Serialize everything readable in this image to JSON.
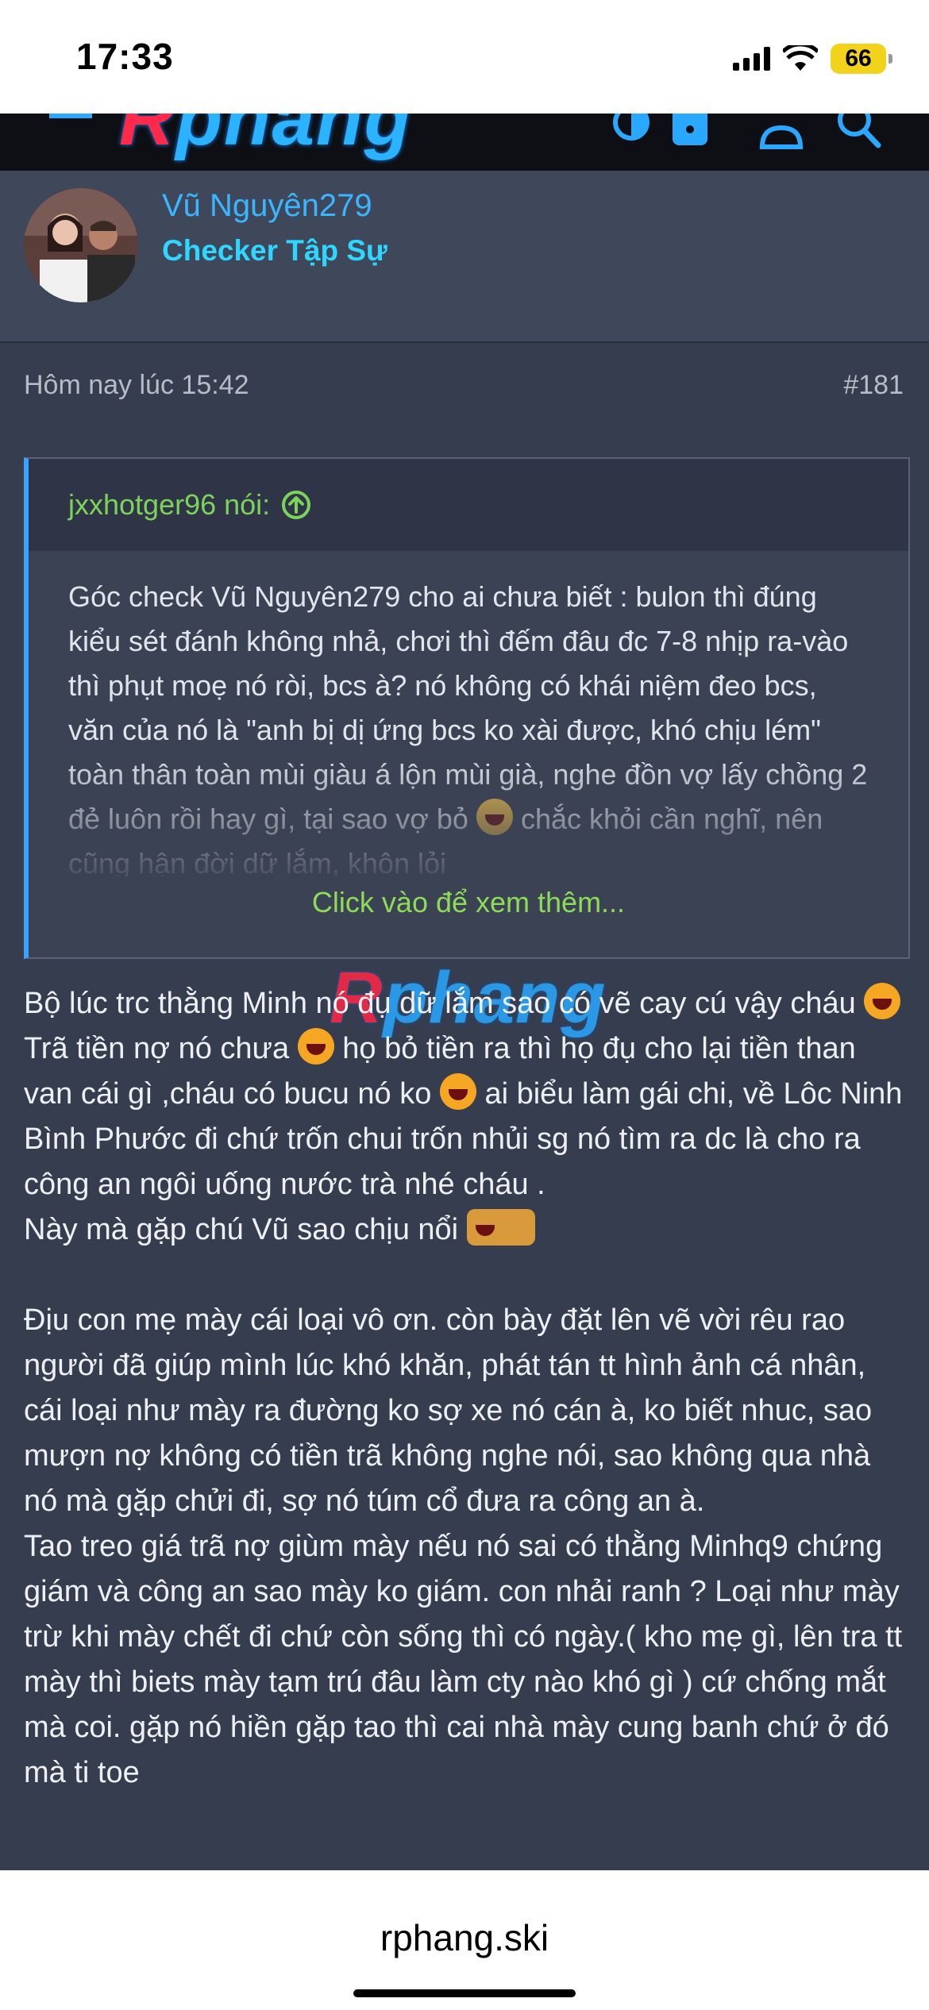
{
  "status_bar": {
    "time": "17:33",
    "battery": "66"
  },
  "header": {
    "logo": "Rphang"
  },
  "post": {
    "username": "Vũ Nguyên279",
    "user_title": "Checker Tập Sự",
    "timestamp": "Hôm nay lúc 15:42",
    "post_number": "#181",
    "quote": {
      "author": "jxxhotger96 nói:",
      "text": "Góc check Vũ Nguyên279 cho ai chưa biết : bulon thì đúng kiểu sét đánh không nhả, chơi thì đếm đâu đc 7-8 nhịp ra-vào thì phụt moẹ nó ròi, bcs à? nó không có khái niệm đeo bcs, văn của nó là \"anh bị dị ứng bcs ko xài được, khó chịu lém\" toàn thân toàn mùi giàu á lộn mùi già, nghe đồn vợ lấy chồng 2 đẻ luôn rồi hay gì, tại sao vợ bỏ",
      "text_faded": "chắc khỏi cần nghĩ, nên cũng hận đời dữ lắm, khôn lỏi",
      "more": "Click vào để xem thêm..."
    },
    "watermark": "Rphang",
    "body": {
      "p1_a": "Bộ lúc trc thằng Minh nó đụ dữ lắm sao có vẽ cay cú vậy cháu",
      "p1_b": "Trã tiền nợ nó chưa",
      "p1_c": "họ bỏ tiền ra thì họ đụ cho lại tiền than van cái gì ,cháu có bucu nó ko",
      "p1_d": "ai biểu làm gái chi, về Lôc Ninh Bình Phước đi chứ trốn chui trốn nhủi sg nó tìm ra dc là cho ra công an ngôi uống nước trà nhé cháu .",
      "p2": "Này mà gặp chú Vũ sao chịu nổi",
      "p3": "Địu con mẹ mày cái loại vô ơn. còn bày đặt lên vẽ vời rêu rao người đã giúp mình lúc khó khăn, phát tán tt hình ảnh cá nhân, cái loại như mày ra đường ko sợ xe nó cán à, ko biết nhuc, sao mượn nợ không có tiền trã không nghe nói, sao không qua nhà nó mà gặp chửi đi, sợ nó túm cổ đưa ra công an à.",
      "p4": "Tao treo giá trã nợ giùm mày nếu nó sai có thằng Minhq9 chứng giám và công an sao mày ko giám. con nhải ranh ? Loại như mày trừ khi mày chết đi chứ còn sống thì có ngày.( kho mẹ gì, lên tra tt mày thì biets mày tạm trú đâu làm cty nào khó gì ) cứ chống mắt mà coi. gặp nó hiền gặp tao thì cai nhà mày cung banh chứ ở đó mà ti toe"
    }
  },
  "browser": {
    "url": "rphang.ski"
  },
  "colors": {
    "background": "#363d4f",
    "username": "#3ab5ff",
    "user_title": "#2fd6ff",
    "quote_accent": "#3aa3ff",
    "quote_author": "#7cd35c"
  }
}
